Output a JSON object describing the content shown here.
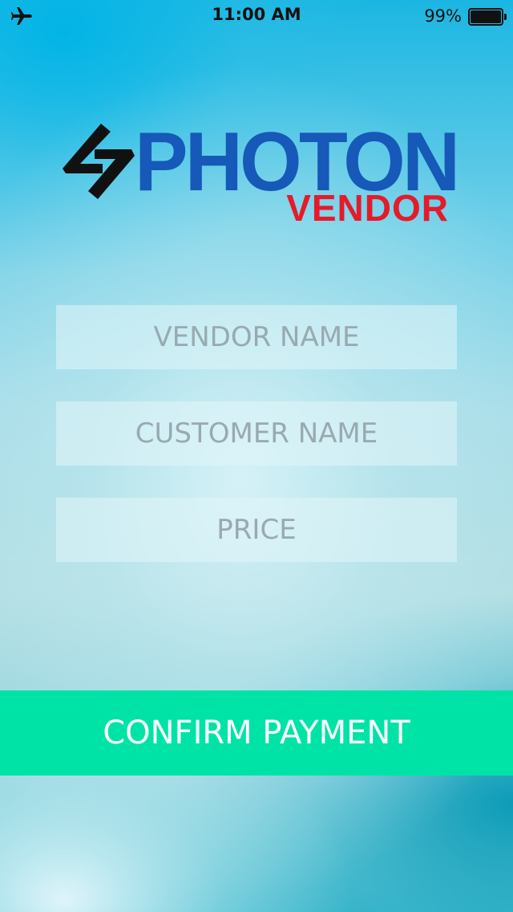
{
  "status_bar": {
    "airplane_icon": "airplane-icon",
    "time": "11:00 AM",
    "battery_percent": "99%",
    "battery_level": 0.99
  },
  "logo": {
    "word": "PHOTON",
    "sub": "VENDOR",
    "colors": {
      "word": "#1659b8",
      "sub": "#e41b2a",
      "mark": "#111111"
    }
  },
  "form": {
    "vendor_placeholder": "VENDOR NAME",
    "customer_placeholder": "CUSTOMER NAME",
    "price_placeholder": "PRICE",
    "vendor_value": "",
    "customer_value": "",
    "price_value": ""
  },
  "confirm": {
    "label": "CONFIRM PAYMENT",
    "color": "#00e3a6"
  }
}
